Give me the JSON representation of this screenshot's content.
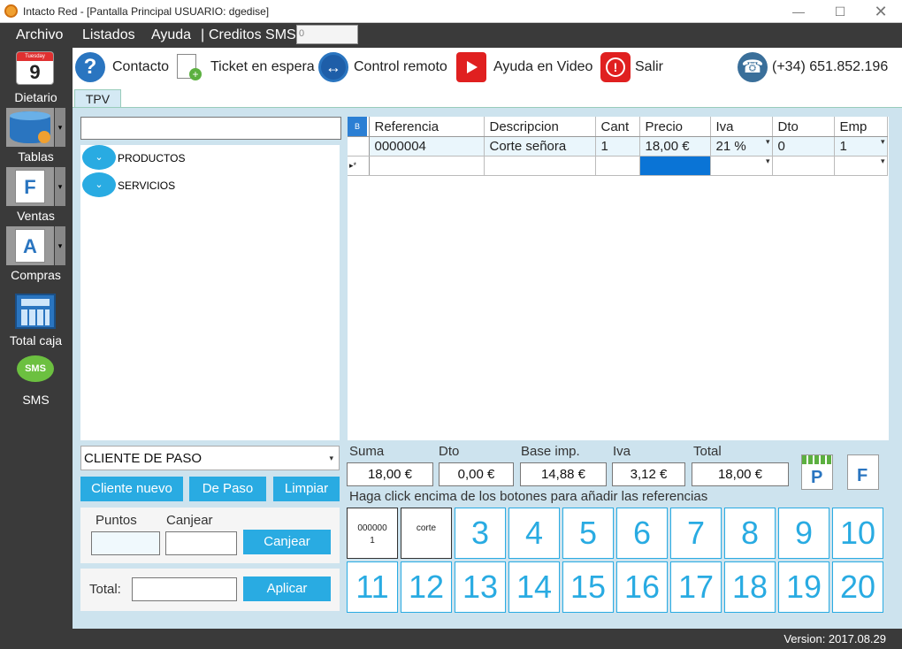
{
  "window": {
    "title": "Intacto Red - [Pantalla Principal USUARIO: dgedise]"
  },
  "menu": {
    "archivo": "Archivo",
    "listados": "Listados",
    "ayuda": "Ayuda",
    "creditos_label": "Creditos SMS",
    "creditos_value": "0"
  },
  "sidebar": {
    "calendar_header": "Tuesday",
    "calendar_day": "9",
    "items": [
      {
        "label": "Dietario",
        "icon": "calendar-icon"
      },
      {
        "label": "Tablas",
        "icon": "database-icon"
      },
      {
        "label": "Ventas",
        "icon": "invoice-icon"
      },
      {
        "label": "Compras",
        "icon": "document-icon"
      },
      {
        "label": "Total caja",
        "icon": "calculator-icon"
      },
      {
        "label": "SMS",
        "icon": "sms-icon"
      }
    ],
    "sms_badge": "SMS",
    "ventas_letter": "F",
    "compras_letter": "A"
  },
  "toolbar": {
    "contacto": "Contacto",
    "ticket": "Ticket en espera",
    "control": "Control remoto",
    "video": "Ayuda en Video",
    "salir": "Salir",
    "phone": "(+34) 651.852.196"
  },
  "tabs": {
    "tpv": "TPV"
  },
  "tree": {
    "productos": "PRODUCTOS",
    "servicios": "SERVICIOS"
  },
  "grid": {
    "corner": "B",
    "headers": [
      "Referencia",
      "Descripcion",
      "Cant",
      "Precio",
      "Iva",
      "Dto",
      "Emp"
    ],
    "rows": [
      [
        "0000004",
        "Corte señora",
        "1",
        "18,00 €",
        "21 %",
        "0",
        "1"
      ]
    ],
    "new_row_marker": "▸*"
  },
  "customer": {
    "selected": "CLIENTE DE PASO",
    "nuevo": "Cliente nuevo",
    "depaso": "De Paso",
    "limpiar": "Limpiar"
  },
  "points": {
    "puntos": "Puntos",
    "canjear_label": "Canjear",
    "canjear_btn": "Canjear"
  },
  "total_panel": {
    "label": "Total:",
    "aplicar": "Aplicar"
  },
  "summary": {
    "suma_label": "Suma",
    "suma": "18,00 €",
    "dto_label": "Dto",
    "dto": "0,00 €",
    "base_label": "Base imp.",
    "base": "14,88 €",
    "iva_label": "Iva",
    "iva": "3,12 €",
    "total_label": "Total",
    "total": "18,00 €"
  },
  "print_icons": {
    "p_letter": "P",
    "f_letter": "F"
  },
  "hint": "Haga click encima de los botones para añadir las referencias",
  "keys": [
    "0000001",
    "corte",
    "3",
    "4",
    "5",
    "6",
    "7",
    "8",
    "9",
    "10",
    "11",
    "12",
    "13",
    "14",
    "15",
    "16",
    "17",
    "18",
    "19",
    "20"
  ],
  "status": {
    "version": "Version: 2017.08.29"
  }
}
